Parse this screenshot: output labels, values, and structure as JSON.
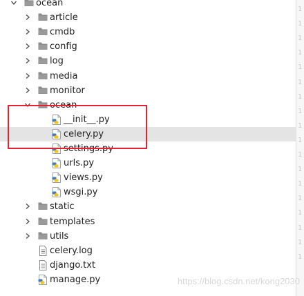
{
  "tree": {
    "root": {
      "label": "ocean",
      "icon": "folder-icon"
    },
    "top_folders": [
      {
        "label": "article",
        "icon": "folder-icon"
      },
      {
        "label": "cmdb",
        "icon": "folder-icon"
      },
      {
        "label": "config",
        "icon": "folder-icon"
      },
      {
        "label": "log",
        "icon": "folder-icon"
      },
      {
        "label": "media",
        "icon": "folder-icon"
      },
      {
        "label": "monitor",
        "icon": "folder-icon"
      }
    ],
    "ocean_folder": {
      "label": "ocean",
      "icon": "folder-icon",
      "files": [
        {
          "label": "__init__.py",
          "icon": "python-file-icon"
        },
        {
          "label": "celery.py",
          "icon": "python-file-icon"
        },
        {
          "label": "settings.py",
          "icon": "python-file-icon"
        },
        {
          "label": "urls.py",
          "icon": "python-file-icon"
        },
        {
          "label": "views.py",
          "icon": "python-file-icon"
        },
        {
          "label": "wsgi.py",
          "icon": "python-file-icon"
        }
      ]
    },
    "bottom_folders": [
      {
        "label": "static",
        "icon": "folder-icon"
      },
      {
        "label": "templates",
        "icon": "folder-icon"
      },
      {
        "label": "utils",
        "icon": "folder-icon"
      }
    ],
    "root_files": [
      {
        "label": "celery.log",
        "icon": "text-file-icon"
      },
      {
        "label": "django.txt",
        "icon": "text-file-icon"
      },
      {
        "label": "manage.py",
        "icon": "python-file-icon"
      }
    ]
  },
  "gutter_numbers": [
    "1",
    "1",
    "1",
    "1",
    "1",
    "1",
    "1",
    "1",
    "1",
    "1",
    "1",
    "1",
    "1",
    "1",
    "1",
    "1",
    "1",
    "1"
  ],
  "watermark": "https://blog.csdn.net/kong2030",
  "colors": {
    "highlight_border": "#e0242f",
    "selected_row": "#e4e4e4",
    "folder": "#8c8c8c",
    "python_blue": "#3d7ab8",
    "python_yellow": "#f2c318"
  }
}
